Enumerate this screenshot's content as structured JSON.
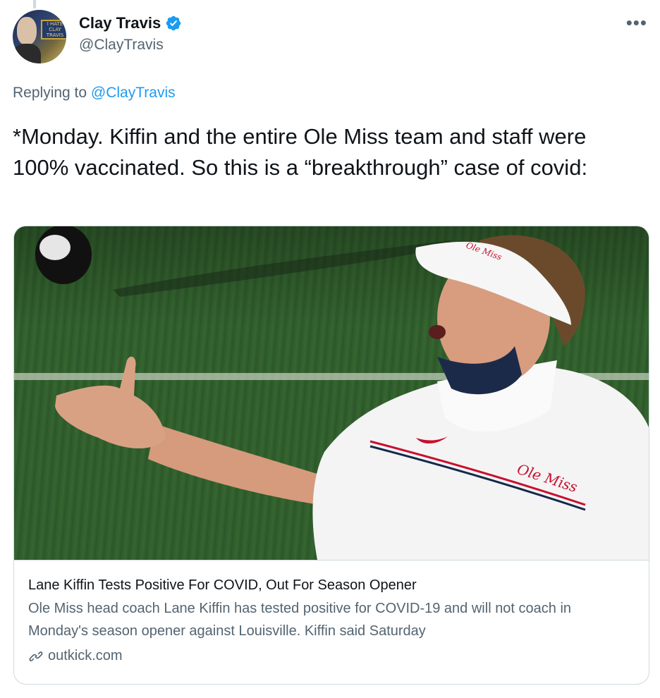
{
  "author": {
    "display_name": "Clay Travis",
    "handle": "@ClayTravis",
    "verified": true,
    "avatar_sign_text": "I HATE CLAY TRAVIS"
  },
  "more_icon": "more-dots-icon",
  "replying": {
    "prefix": "Replying to",
    "mention": "@ClayTravis"
  },
  "tweet": {
    "text": "*Monday. Kiffin and the entire Ole Miss team and staff were 100% vaccinated. So this is a “breakthrough” case of covid:"
  },
  "card": {
    "title": "Lane Kiffin Tests Positive For COVID, Out For Season Opener",
    "description": "Ole Miss head coach Lane Kiffin has tested positive for COVID-19 and will not coach in Monday's season opener against Louisville. Kiffin said Saturday",
    "domain": "outkick.com",
    "image_visor_text": "Ole Miss",
    "image_shirt_text": "Ole Miss"
  },
  "colors": {
    "accent": "#1d9bf0",
    "secondary_text": "#536471",
    "border": "#cfd9de"
  }
}
